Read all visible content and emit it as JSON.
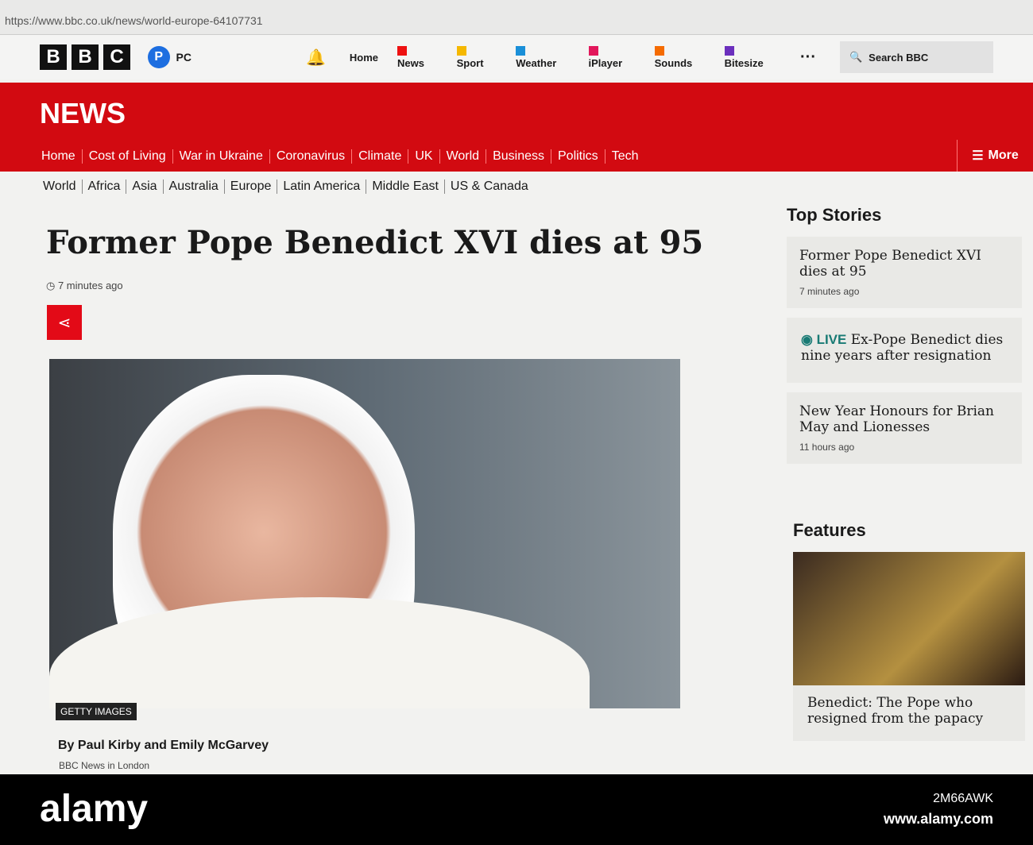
{
  "url": "https://www.bbc.co.uk/news/world-europe-64107731",
  "header": {
    "logo": [
      "B",
      "B",
      "C"
    ],
    "avatar": "P",
    "account": "PC",
    "nav": [
      {
        "label": "Home",
        "color": ""
      },
      {
        "label": "News",
        "color": "#e11"
      },
      {
        "label": "Sport",
        "color": "#f5b800"
      },
      {
        "label": "Weather",
        "color": "#1a8fd8"
      },
      {
        "label": "iPlayer",
        "color": "#e2175b"
      },
      {
        "label": "Sounds",
        "color": "#f56b00"
      },
      {
        "label": "Bitesize",
        "color": "#6b2fbd"
      }
    ],
    "more": "···",
    "search": "Search BBC"
  },
  "news": {
    "logo": "NEWS",
    "nav": [
      "Home",
      "Cost of Living",
      "War in Ukraine",
      "Coronavirus",
      "Climate",
      "UK",
      "World",
      "Business",
      "Politics",
      "Tech"
    ],
    "more": "More",
    "subnav": [
      "World",
      "Africa",
      "Asia",
      "Australia",
      "Europe",
      "Latin America",
      "Middle East",
      "US & Canada"
    ],
    "active_sub": "Europe"
  },
  "article": {
    "title": "Former Pope Benedict XVI dies at 95",
    "time": "7 minutes ago",
    "image_credit": "GETTY IMAGES",
    "byline": "By Paul Kirby and Emily McGarvey",
    "location": "BBC News in London"
  },
  "top_stories": {
    "heading": "Top Stories",
    "items": [
      {
        "title": "Former Pope Benedict XVI dies at 95",
        "time": "7 minutes ago"
      },
      {
        "live": "LIVE",
        "title": "Ex-Pope Benedict dies nine years after resignation"
      },
      {
        "title": "New Year Honours for Brian May and Lionesses",
        "time": "11 hours ago"
      }
    ]
  },
  "features": {
    "heading": "Features",
    "items": [
      {
        "title": "Benedict: The Pope who resigned from the papacy"
      }
    ]
  },
  "watermark": {
    "logo": "alamy",
    "image_id": "2M66AWK",
    "site": "www.alamy.com"
  }
}
